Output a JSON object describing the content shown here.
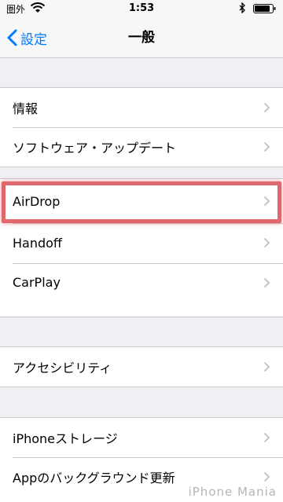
{
  "status_bar": {
    "carrier": "圏外",
    "time": "1:53"
  },
  "nav": {
    "back_label": "設定",
    "title": "一般"
  },
  "groups": [
    {
      "items": [
        {
          "label": "情報"
        },
        {
          "label": "ソフトウェア・アップデート"
        }
      ]
    },
    {
      "items": [
        {
          "label": "AirDrop"
        },
        {
          "label": "Handoff"
        },
        {
          "label": "CarPlay"
        }
      ]
    },
    {
      "items": [
        {
          "label": "アクセシビリティ"
        }
      ]
    },
    {
      "items": [
        {
          "label": "iPhoneストレージ"
        },
        {
          "label": "Appのバックグラウンド更新"
        }
      ]
    }
  ],
  "watermark": "iPhone Mania",
  "colors": {
    "accent": "#007aff",
    "highlight": "#e0676b",
    "background": "#efeff4"
  }
}
